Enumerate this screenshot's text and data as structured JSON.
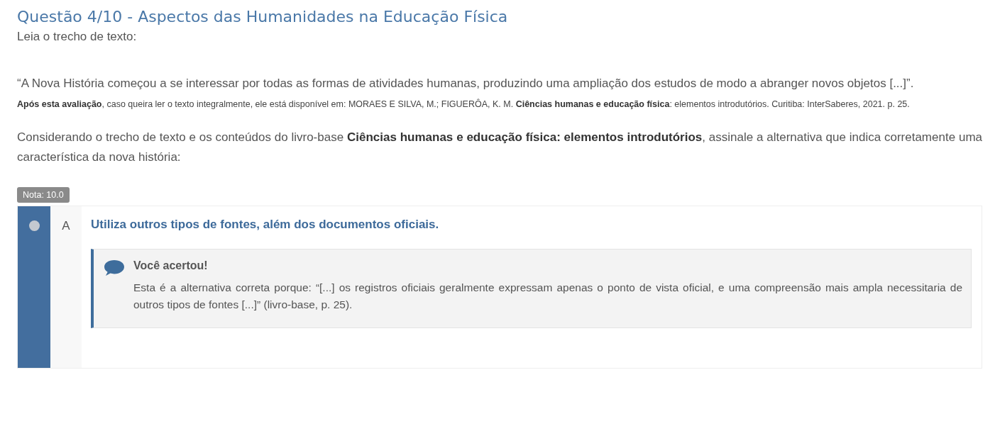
{
  "question": {
    "title": "Questão 4/10 - Aspectos das Humanidades na Educação Física",
    "intro": "Leia o trecho de texto:",
    "quote": "“A Nova História começou a se interessar por todas as formas de atividades humanas, produzindo uma ampliação dos estudos de modo a abranger novos objetos [...]”.",
    "source": "**Após esta avaliação**, caso queira ler o texto integralmente, ele está disponível em: MORAES E SILVA, M.; FIGUERÔA, K. M. **Ciências humanas e educação física**: elementos introdutórios. Curitiba: InterSaberes, 2021. p. 25.",
    "prompt": "Considerando o trecho de texto e os conteúdos do livro-base **Ciências humanas e educação física: elementos introdutórios**, assinale a alternativa que indica corretamente uma característica da nova história:"
  },
  "grade_badge": "Nota: 10.0",
  "options": [
    {
      "letter": "A",
      "text": "Utiliza outros tipos de fontes, além dos documentos oficiais.",
      "selected": true,
      "feedback": {
        "title": "Você acertou!",
        "text": "Esta é a alternativa correta porque: “[...] os registros oficiais geralmente expressam apenas o ponto de vista oficial, e uma compreensão mais ampla necessitaria de outros tipos de fontes [...]” (livro-base, p. 25)."
      }
    }
  ]
}
